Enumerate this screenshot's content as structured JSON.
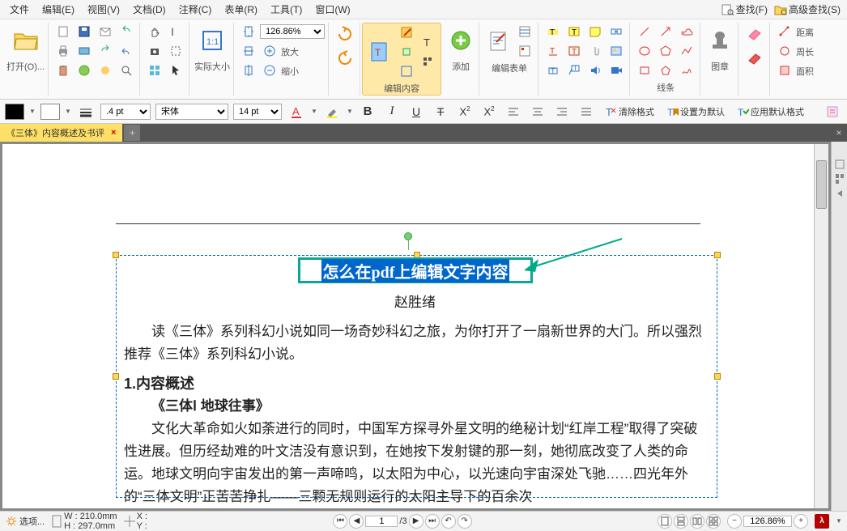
{
  "menu": {
    "file": "文件",
    "edit": "编辑(E)",
    "view": "视图(V)",
    "doc": "文档(D)",
    "comment": "注释(C)",
    "table": "表单(R)",
    "tool": "工具(T)",
    "window": "窗口(W)",
    "find": "查找(F)",
    "advfind": "高级查找(S)"
  },
  "ribbon": {
    "open": "打开(O)...",
    "actual": "实际大小",
    "zoomlabel": "126.86%",
    "zoomin": "放大",
    "zoomout": "缩小",
    "editcontent": "编辑内容",
    "add": "添加",
    "editform": "编辑表单",
    "lines": "线条",
    "stamp": "图章",
    "distance": "距离",
    "perimeter": "周长",
    "area": "面积"
  },
  "fmt": {
    "lineweight": ".4 pt",
    "font": "宋体",
    "size": "14 pt",
    "clear": "清除格式",
    "setdefault": "设置为默认",
    "applydefault": "应用默认格式"
  },
  "tab": {
    "name": "《三体》内容概述及书评"
  },
  "doc": {
    "title": "怎么在pdf上编辑文字内容",
    "author": "赵胜绪",
    "p1": "读《三体》系列科幻小说如同一场奇妙科幻之旅，为你打开了一扇新世界的大门。所以强烈推荐《三体》系列科幻小说。",
    "h1": "1.内容概述",
    "h2": "《三体Ⅰ 地球往事》",
    "p2": "文化大革命如火如荼进行的同时，中国军方探寻外星文明的绝秘计划“红岸工程”取得了突破性进展。但历经劫难的叶文洁没有意识到，在她按下发射键的那一刻，她彻底改变了人类的命运。地球文明向宇宙发出的第一声啼鸣，以太阳为中心，以光速向宇宙深处飞驰……四光年外的“三体文明”正苦苦挣扎——三颗无规则运行的太阳主导下的百余次"
  },
  "status": {
    "options": "选项...",
    "w": "W : 210.0mm",
    "h": "H : 297.0mm",
    "x": "X :",
    "y": "Y :",
    "page": "1",
    "pages": "/3",
    "zoom": "126.86%"
  }
}
